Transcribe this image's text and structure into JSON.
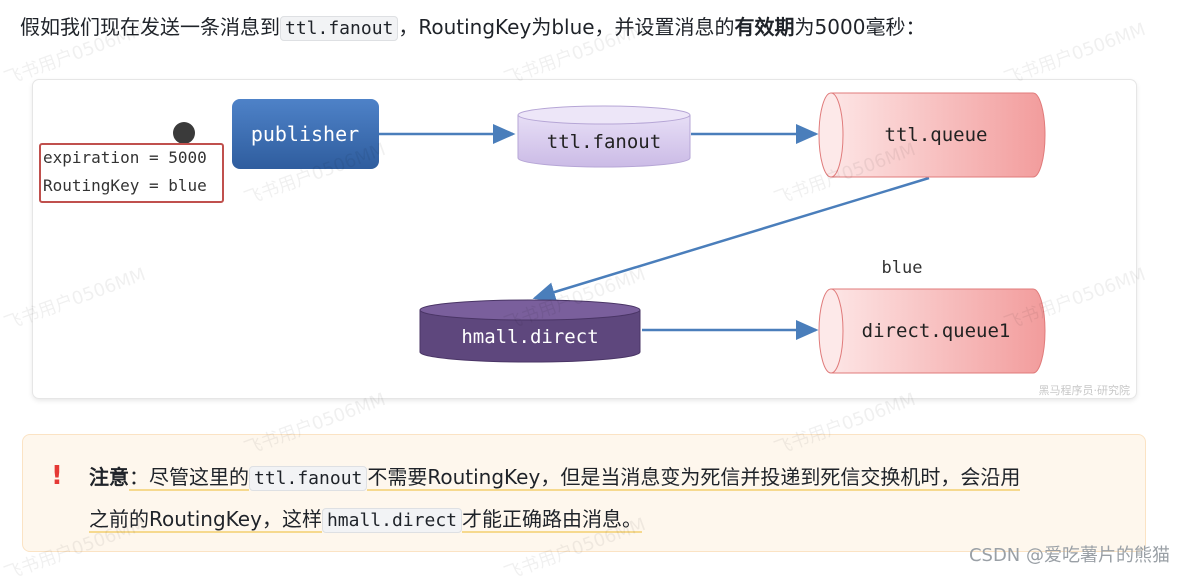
{
  "intro": {
    "part1": "假如我们现在发送一条消息到",
    "code": "ttl.fanout",
    "part2": "，RoutingKey为blue，并设置消息的",
    "bold": "有效期",
    "part3": "为5000毫秒："
  },
  "diagram": {
    "message_lines": [
      "expiration = 5000",
      "RoutingKey = blue"
    ],
    "publisher": "publisher",
    "ttl_fanout": "ttl.fanout",
    "ttl_queue": "ttl.queue",
    "hmall_direct": "hmall.direct",
    "direct_queue": "direct.queue1",
    "binding_label": "blue",
    "credit": "黑马程序员·研究院",
    "colors": {
      "publisher": "#3f6fb5",
      "exchange_light": "#d9cdee",
      "exchange_dark": "#5e477d",
      "queue": "#f6b8b8",
      "arrow": "#4a7ebb",
      "message_border": "#c0504d"
    }
  },
  "note": {
    "icon": "!",
    "label": "注意",
    "text1": "：尽管这里的",
    "code1": "ttl.fanout",
    "text2": "不需要RoutingKey，但是当消息变为死信并投递到死信交换机时，会沿用",
    "text3": "之前的RoutingKey，这样",
    "code2": "hmall.direct",
    "text4": "才能正确路由消息。"
  },
  "footer": {
    "csdn": "CSDN @爱吃薯片的熊猫"
  },
  "watermark": "飞书用户0506MM"
}
